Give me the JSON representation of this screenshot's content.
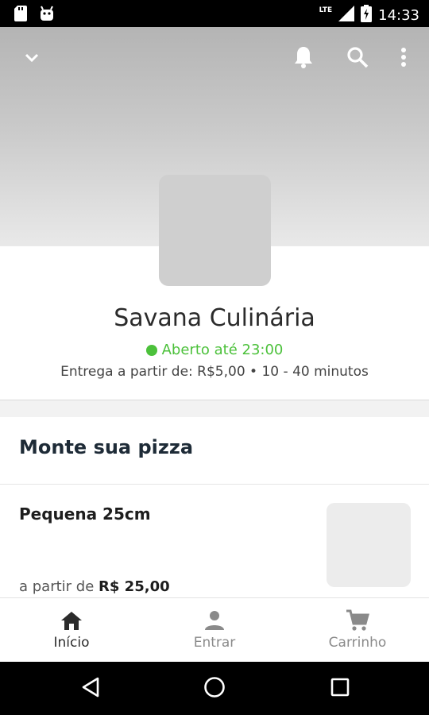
{
  "status_bar": {
    "time": "14:33",
    "network": "LTE",
    "icons": [
      "sd-card-icon",
      "android-icon",
      "signal-icon",
      "battery-charging-icon"
    ]
  },
  "header": {
    "icons": [
      "chevron-down-icon",
      "bell-icon",
      "search-icon",
      "more-vert-icon"
    ]
  },
  "store": {
    "name": "Savana Culinária",
    "open_status": "Aberto até 23:00",
    "delivery_info": "Entrega a partir de: R$5,00 • 10 - 40 minutos"
  },
  "menu": {
    "section_title": "Monte sua pizza",
    "items": [
      {
        "name": "Pequena 25cm",
        "price_prefix": "a partir de",
        "price": "R$ 25,00"
      }
    ]
  },
  "bottom_nav": {
    "items": [
      {
        "label": "Início",
        "icon": "home-icon",
        "active": true
      },
      {
        "label": "Entrar",
        "icon": "person-icon",
        "active": false
      },
      {
        "label": "Carrinho",
        "icon": "cart-icon",
        "active": false
      }
    ]
  },
  "colors": {
    "open_green": "#4cc13b",
    "header_gradient_top": "#b4b4b4",
    "header_gradient_bottom": "#e9e9e9",
    "section_title": "#1e2b37"
  }
}
